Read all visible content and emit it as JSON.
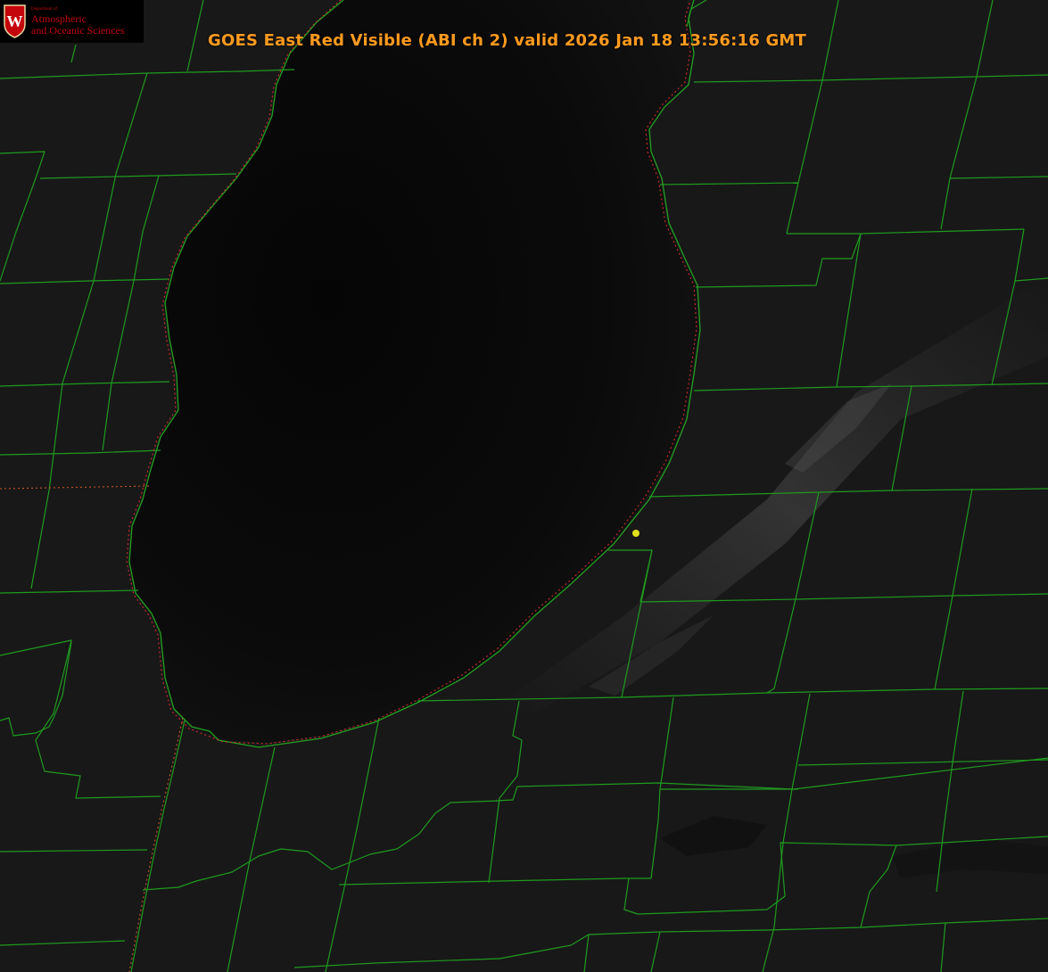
{
  "title": "GOES East Red Visible (ABI ch 2) valid 2026 Jan 18 13:56:16 GMT",
  "logo": {
    "department_label": "Department of",
    "name_line1": "Atmospheric",
    "name_line2": "and Oceanic Sciences",
    "crest_letter": "W"
  },
  "colors": {
    "background": "#151515",
    "lake": "#070707",
    "county_lines": "#1f9a1f",
    "state_lines": "#c2532a",
    "shoreline_outline": "#d22a2a",
    "title_text": "#ff9a1f",
    "logo_text": "#c5050c",
    "station_marker": "#e0e020"
  },
  "layers": {
    "base_image": "GOES East Red Visible (ABI ch 2)",
    "overlays": [
      "county-boundaries",
      "state-boundaries",
      "shoreline",
      "station-marker"
    ]
  }
}
